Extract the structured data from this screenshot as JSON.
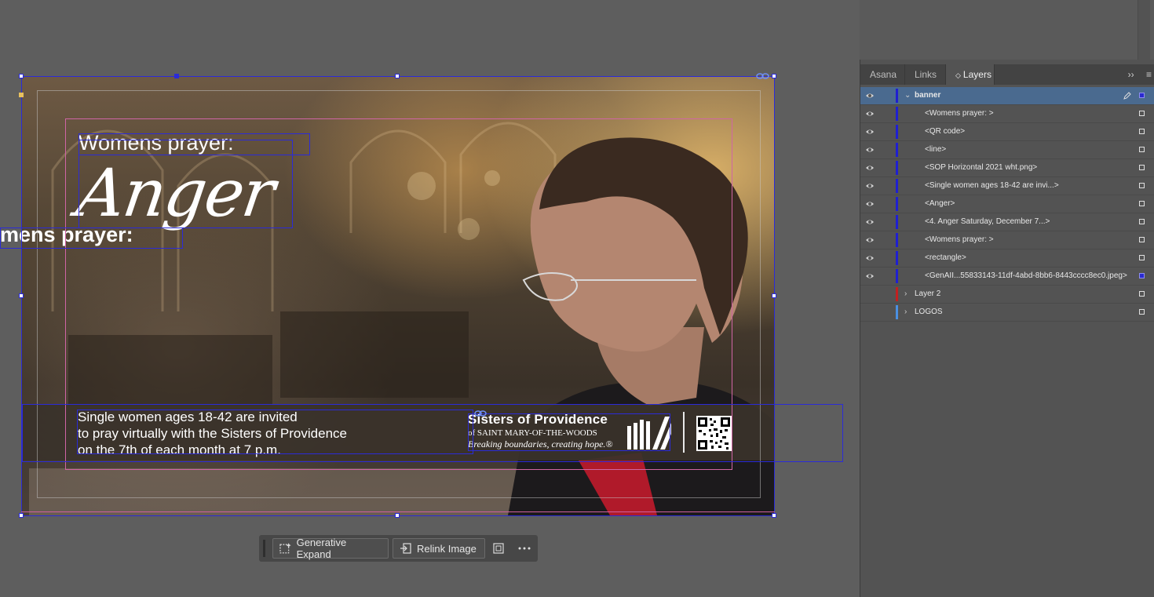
{
  "artwork": {
    "title_small": "Womens prayer:",
    "title_large": "Anger",
    "overflow_text": "mens prayer:",
    "band_lines": [
      "Single women ages 18-42 are invited",
      "to pray virtually with the Sisters of Providence",
      "on the 7th of each month at 7 p.m."
    ],
    "logo_line1": "Sisters of Providence",
    "logo_line2": "of SAINT MARY-OF-THE-WOODS",
    "logo_line3": "Breaking boundaries, creating hope.®"
  },
  "context_bar": {
    "generative_expand": "Generative Expand",
    "relink_image": "Relink Image"
  },
  "panel": {
    "tabs": [
      "Asana",
      "Links",
      "Layers"
    ],
    "active_tab": "Layers",
    "layers": [
      {
        "name": "banner",
        "type": "layer",
        "expanded": true,
        "selected": true,
        "color": "#1f1fd1"
      },
      {
        "name": "<Womens prayer: >",
        "type": "item",
        "color": "#1f1fd1"
      },
      {
        "name": "<QR code>",
        "type": "item",
        "color": "#1f1fd1"
      },
      {
        "name": "<line>",
        "type": "item",
        "color": "#1f1fd1"
      },
      {
        "name": "<SOP Horizontal 2021 wht.png>",
        "type": "item",
        "color": "#1f1fd1"
      },
      {
        "name": "<Single women ages 18-42 are invi...>",
        "type": "item",
        "color": "#1f1fd1"
      },
      {
        "name": "<Anger>",
        "type": "item",
        "color": "#1f1fd1"
      },
      {
        "name": "<4.    Anger Saturday, December 7...>",
        "type": "item",
        "color": "#1f1fd1"
      },
      {
        "name": "<Womens prayer: >",
        "type": "item",
        "color": "#1f1fd1"
      },
      {
        "name": "<rectangle>",
        "type": "item",
        "color": "#1f1fd1"
      },
      {
        "name": "<GenAII...55833143-11df-4abd-8bb6-8443cccc8ec0.jpeg>",
        "type": "item",
        "color": "#1f1fd1",
        "filled": true
      },
      {
        "name": "Layer 2",
        "type": "layer",
        "expanded": false,
        "color": "#c22020"
      },
      {
        "name": "LOGOS",
        "type": "layer",
        "expanded": false,
        "color": "#4a90e2"
      }
    ]
  }
}
